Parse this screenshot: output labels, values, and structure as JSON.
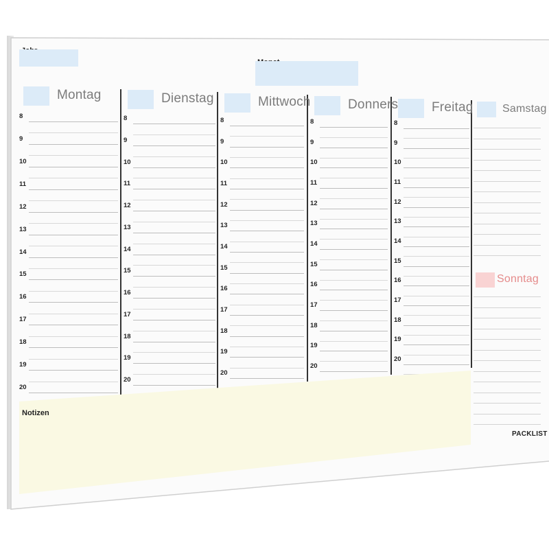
{
  "header": {
    "year_label": "Jahr",
    "month_label": "Monat"
  },
  "days": [
    "Montag",
    "Dienstag",
    "Mittwoch",
    "Donnerstag",
    "Freitag",
    "Samstag"
  ],
  "sunday_label": "Sonntag",
  "hours": [
    "8",
    "9",
    "10",
    "11",
    "12",
    "13",
    "14",
    "15",
    "16",
    "17",
    "18",
    "19",
    "20"
  ],
  "notes_label": "Notizen",
  "brand": "PACKLIST",
  "colors": {
    "day_box": "#dcebf8",
    "sunday_box": "#f9d3d3",
    "notes_area": "#faf9e3",
    "sunday_text": "#e58b8b"
  }
}
